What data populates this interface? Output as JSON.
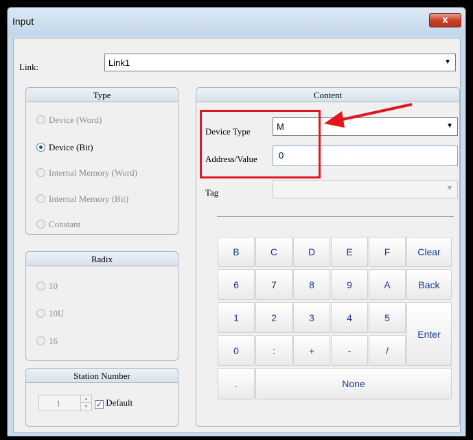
{
  "window": {
    "title": "Input",
    "close_label": "x"
  },
  "link": {
    "label": "Link:",
    "value": "Link1"
  },
  "type_group": {
    "title": "Type",
    "options": [
      {
        "label": "Device (Word)",
        "checked": false,
        "enabled": false
      },
      {
        "label": "Device (Bit)",
        "checked": true,
        "enabled": true
      },
      {
        "label": "Internal Memory (Word)",
        "checked": false,
        "enabled": false
      },
      {
        "label": "Internal Memory (Bit)",
        "checked": false,
        "enabled": false
      },
      {
        "label": "Constant",
        "checked": false,
        "enabled": false
      }
    ]
  },
  "radix_group": {
    "title": "Radix",
    "options": [
      {
        "label": "10"
      },
      {
        "label": "10U"
      },
      {
        "label": "16"
      }
    ]
  },
  "station_group": {
    "title": "Station Number",
    "value": "1",
    "default_label": "Default",
    "default_checked": true
  },
  "content_group": {
    "title": "Content",
    "device_type_label": "Device Type",
    "device_type_value": "M",
    "address_label": "Address/Value",
    "address_value": "0",
    "tag_label": "Tag",
    "tag_value": ""
  },
  "keypad": {
    "rows": [
      [
        "B",
        "C",
        "D",
        "E",
        "F",
        "Clear"
      ],
      [
        "6",
        "7",
        "8",
        "9",
        "A",
        "Back"
      ],
      [
        "1",
        "2",
        "3",
        "4",
        "5",
        "Enter"
      ],
      [
        "0",
        ":",
        "+",
        "-",
        "/"
      ],
      [
        ".",
        "None"
      ]
    ]
  },
  "colors": {
    "annotation": "#e0171f",
    "title_bg": "#c9dced",
    "key_text": "#1a3a8a"
  }
}
